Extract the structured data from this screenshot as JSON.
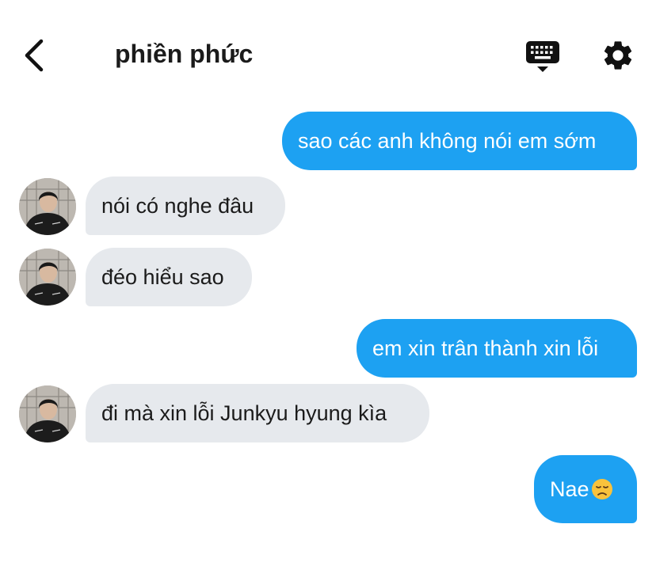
{
  "header": {
    "title": "phiền phức",
    "back_icon": "chevron-left-icon",
    "keyboard_icon": "keyboard-icon",
    "settings_icon": "gear-icon"
  },
  "messages": [
    {
      "direction": "outgoing",
      "text": "sao các anh không nói em sớm"
    },
    {
      "direction": "incoming",
      "text": "nói có nghe đâu"
    },
    {
      "direction": "incoming",
      "text": "đéo hiểu sao"
    },
    {
      "direction": "outgoing",
      "text": "em xin trân thành xin lỗi"
    },
    {
      "direction": "incoming",
      "text": "đi mà xin lỗi Junkyu hyung kìa"
    },
    {
      "direction": "outgoing",
      "text": "Nae",
      "emoji": "disappointed-face-emoji"
    }
  ],
  "colors": {
    "outgoing_bubble": "#1da1f2",
    "incoming_bubble": "#e6e9ed",
    "title_text": "#1b1b1b"
  }
}
